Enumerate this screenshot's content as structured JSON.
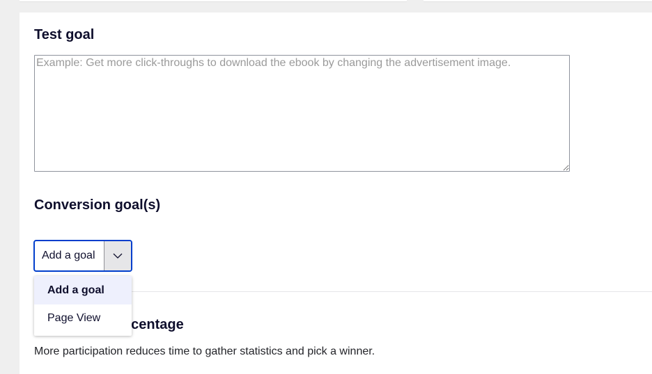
{
  "test_goal": {
    "heading": "Test goal",
    "placeholder": "Example: Get more click-throughs to download the ebook by changing the advertisement image.",
    "value": ""
  },
  "conversion_goals": {
    "heading": "Conversion goal(s)",
    "select": {
      "selected_label": "Add a goal",
      "icon": "chevron-down-icon"
    },
    "dropdown": {
      "options": [
        {
          "label": "Add a goal",
          "selected": true
        },
        {
          "label": "Page View",
          "selected": false
        }
      ]
    }
  },
  "participation": {
    "heading_visible": "percentage",
    "description": "More participation reduces time to gather statistics and pick a winner."
  },
  "colors": {
    "focus_border": "#003ecc",
    "selected_option_bg": "#eef0fd",
    "text": "#0e0e2c",
    "page_bg": "#efefef"
  }
}
